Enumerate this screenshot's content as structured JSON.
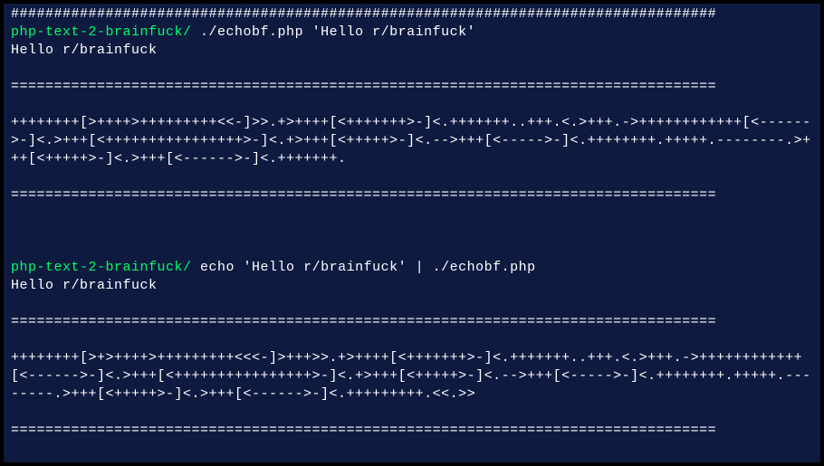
{
  "terminal": {
    "lines": [
      {
        "type": "output",
        "text": "##################################################################################"
      },
      {
        "type": "prompt",
        "prompt": "php-text-2-brainfuck/ ",
        "command": "./echobf.php 'Hello r/brainfuck'"
      },
      {
        "type": "output",
        "text": "Hello r/brainfuck"
      },
      {
        "type": "blank"
      },
      {
        "type": "output",
        "text": "=================================================================================="
      },
      {
        "type": "blank"
      },
      {
        "type": "output",
        "text": "++++++++[>++++>+++++++++<<-]>>.+>++++[<+++++++>-]<.+++++++..+++.<.>+++.->++++++++++++[<------>-]<.>+++[<++++++++++++++++>-]<.+>+++[<+++++>-]<.-->+++[<----->-]<.++++++++.+++++.--------.>+++[<+++++>-]<.>+++[<------>-]<.+++++++."
      },
      {
        "type": "blank"
      },
      {
        "type": "output",
        "text": "=================================================================================="
      },
      {
        "type": "blank"
      },
      {
        "type": "blank"
      },
      {
        "type": "blank"
      },
      {
        "type": "prompt",
        "prompt": "php-text-2-brainfuck/ ",
        "command": "echo 'Hello r/brainfuck' | ./echobf.php"
      },
      {
        "type": "output",
        "text": "Hello r/brainfuck"
      },
      {
        "type": "blank"
      },
      {
        "type": "output",
        "text": "=================================================================================="
      },
      {
        "type": "blank"
      },
      {
        "type": "output",
        "text": "++++++++[>+>++++>+++++++++<<<-]>+++>>.+>++++[<+++++++>-]<.+++++++..+++.<.>+++.->++++++++++++[<------>-]<.>+++[<++++++++++++++++>-]<.+>+++[<+++++>-]<.-->+++[<----->-]<.++++++++.+++++.--------.>+++[<+++++>-]<.>+++[<------>-]<.+++++++++.<<.>>"
      },
      {
        "type": "blank"
      },
      {
        "type": "output",
        "text": "=================================================================================="
      }
    ]
  }
}
